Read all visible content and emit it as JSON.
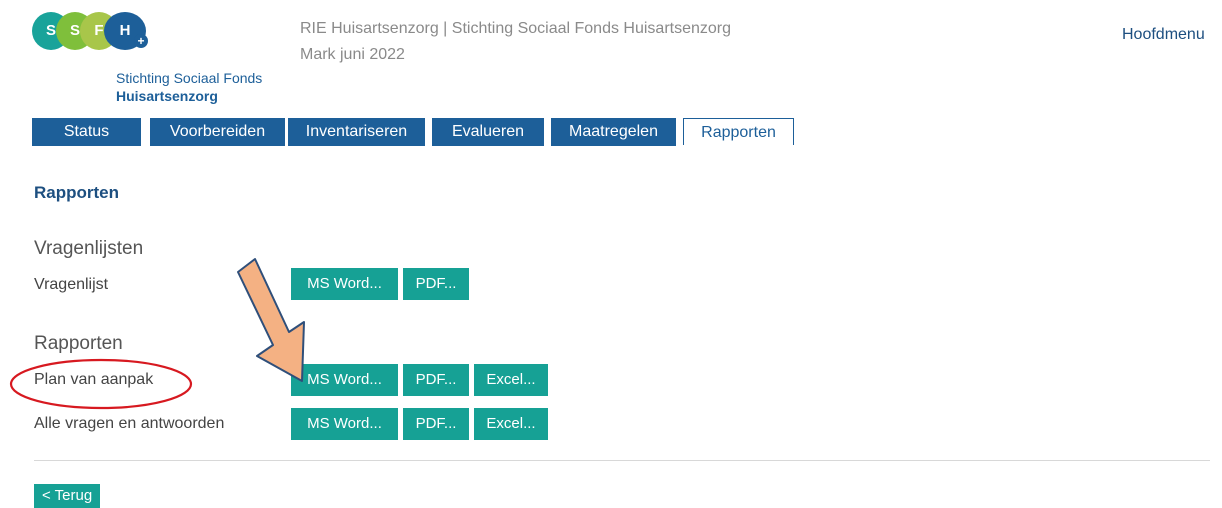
{
  "logo": {
    "letters": [
      "S",
      "S",
      "F",
      "H"
    ],
    "line1": "Stichting Sociaal Fonds",
    "line2": "Huisartsenzorg"
  },
  "header": {
    "line1": "RIE Huisartsenzorg  |  Stichting Sociaal Fonds Huisartsenzorg",
    "line2": "Mark juni 2022",
    "menu": "Hoofdmenu"
  },
  "tabs": [
    {
      "label": "Status"
    },
    {
      "label": "Voorbereiden"
    },
    {
      "label": "Inventariseren"
    },
    {
      "label": "Evalueren"
    },
    {
      "label": "Maatregelen"
    },
    {
      "label": "Rapporten",
      "active": true
    }
  ],
  "page": {
    "title": "Rapporten",
    "sections": [
      {
        "heading": "Vragenlijsten",
        "rows": [
          {
            "label": "Vragenlijst",
            "buttons": [
              "MS Word...",
              "PDF..."
            ]
          }
        ]
      },
      {
        "heading": "Rapporten",
        "rows": [
          {
            "label": "Plan van aanpak",
            "buttons": [
              "MS Word...",
              "PDF...",
              "Excel..."
            ]
          },
          {
            "label": "Alle vragen en antwoorden",
            "buttons": [
              "MS Word...",
              "PDF...",
              "Excel..."
            ]
          }
        ]
      }
    ],
    "back": "< Terug"
  },
  "colors": {
    "primary": "#1d5f99",
    "button": "#16a195",
    "arrow": "#f4b183",
    "circle": "#d71920"
  }
}
